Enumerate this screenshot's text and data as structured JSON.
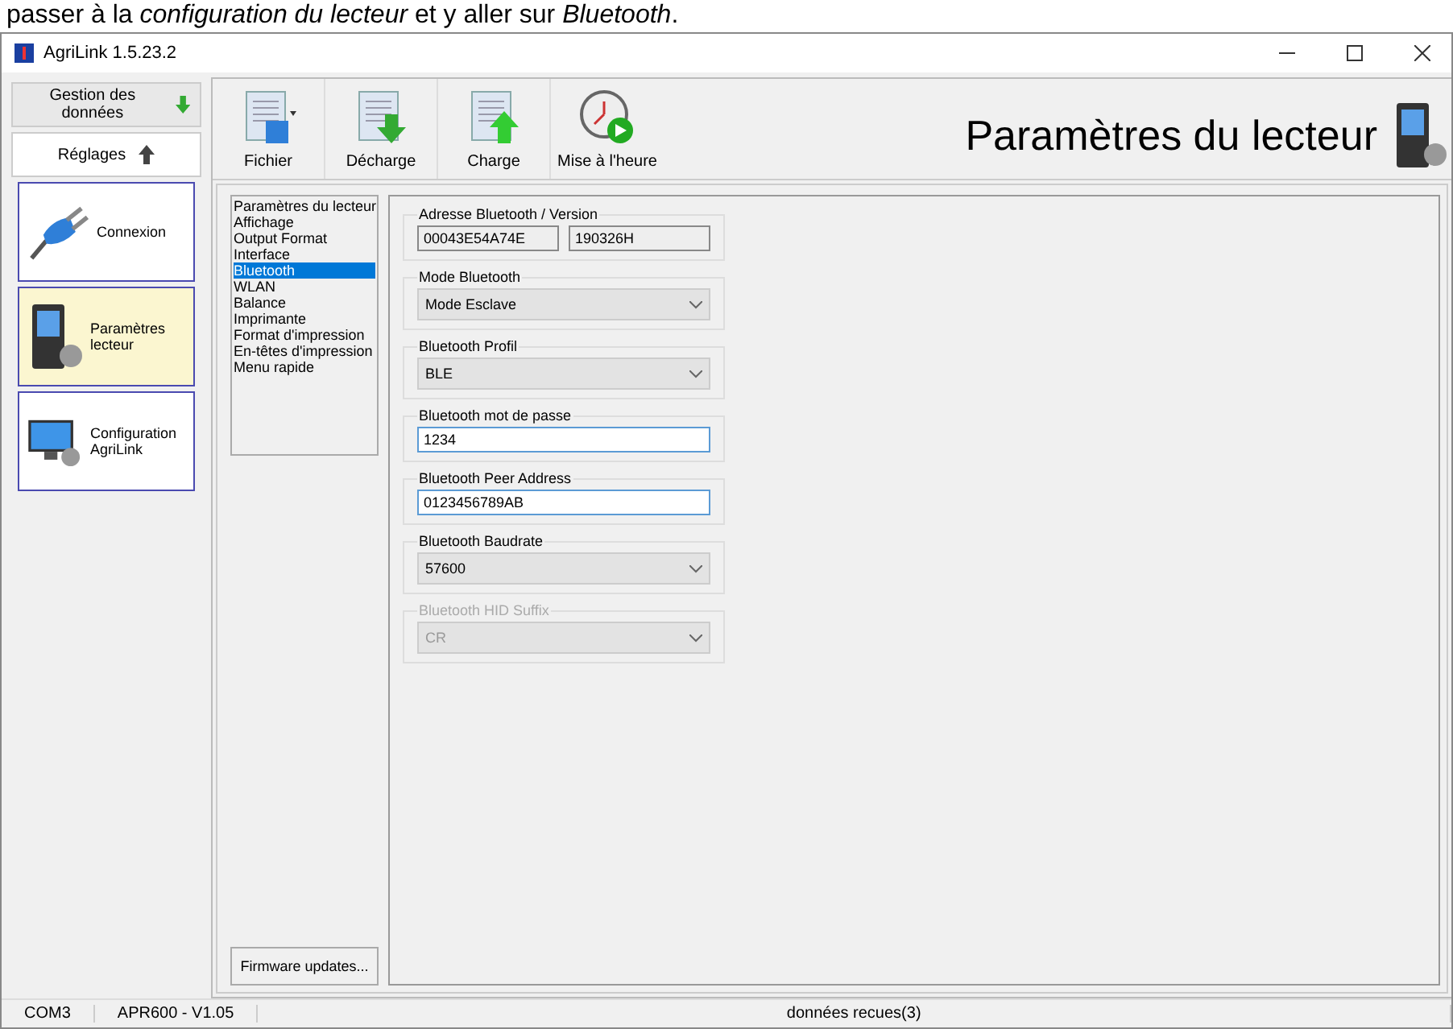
{
  "caption": "passer à la *configuration du lecteur* et y aller sur *Bluetooth*.",
  "window": {
    "title": "AgriLink 1.5.23.2"
  },
  "nav_buttons": [
    {
      "label": "Gestion des données",
      "kind": "down",
      "selected": false
    },
    {
      "label": "Réglages",
      "kind": "up",
      "selected": true
    }
  ],
  "nav_items": [
    {
      "label": "Connexion",
      "kind": "plug",
      "selected": false
    },
    {
      "label": "Paramètres lecteur",
      "kind": "reader",
      "selected": true
    },
    {
      "label": "Configuration AgriLink",
      "kind": "monitor",
      "selected": false
    }
  ],
  "toolbar": [
    {
      "label": "Fichier",
      "kind": "file"
    },
    {
      "label": "Décharge",
      "kind": "download"
    },
    {
      "label": "Charge",
      "kind": "upload"
    },
    {
      "label": "Mise à l'heure",
      "kind": "clock"
    }
  ],
  "page_title": "Paramètres du lecteur",
  "settings_list": [
    {
      "label": "Paramètres du lecteur",
      "selected": false
    },
    {
      "label": "Affichage",
      "selected": false
    },
    {
      "label": "Output Format",
      "selected": false
    },
    {
      "label": "Interface",
      "selected": false
    },
    {
      "label": "Bluetooth",
      "selected": true
    },
    {
      "label": "WLAN",
      "selected": false
    },
    {
      "label": "Balance",
      "selected": false
    },
    {
      "label": "Imprimante",
      "selected": false
    },
    {
      "label": "Format d'impression",
      "selected": false
    },
    {
      "label": "En-têtes d'impression",
      "selected": false
    },
    {
      "label": "Menu rapide",
      "selected": false
    }
  ],
  "firmware_button": "Firmware updates...",
  "groups": [
    {
      "label": "Adresse Bluetooth / Version",
      "kind": "pair",
      "values": [
        "00043E54A74E",
        "190326H"
      ]
    },
    {
      "label": "Mode Bluetooth",
      "kind": "select",
      "value": "Mode Esclave",
      "disabled": false
    },
    {
      "label": "Bluetooth Profil",
      "kind": "select",
      "value": "BLE",
      "disabled": false
    },
    {
      "label": "Bluetooth mot de passe",
      "kind": "text",
      "value": "1234"
    },
    {
      "label": "Bluetooth Peer Address",
      "kind": "text",
      "value": "0123456789AB"
    },
    {
      "label": "Bluetooth Baudrate",
      "kind": "select",
      "value": "57600",
      "disabled": false
    },
    {
      "label": "Bluetooth HID Suffix",
      "kind": "select",
      "value": "CR",
      "disabled": true
    }
  ],
  "status_bar": [
    "COM3",
    "APR600 - V1.05",
    "données recues(3)"
  ]
}
